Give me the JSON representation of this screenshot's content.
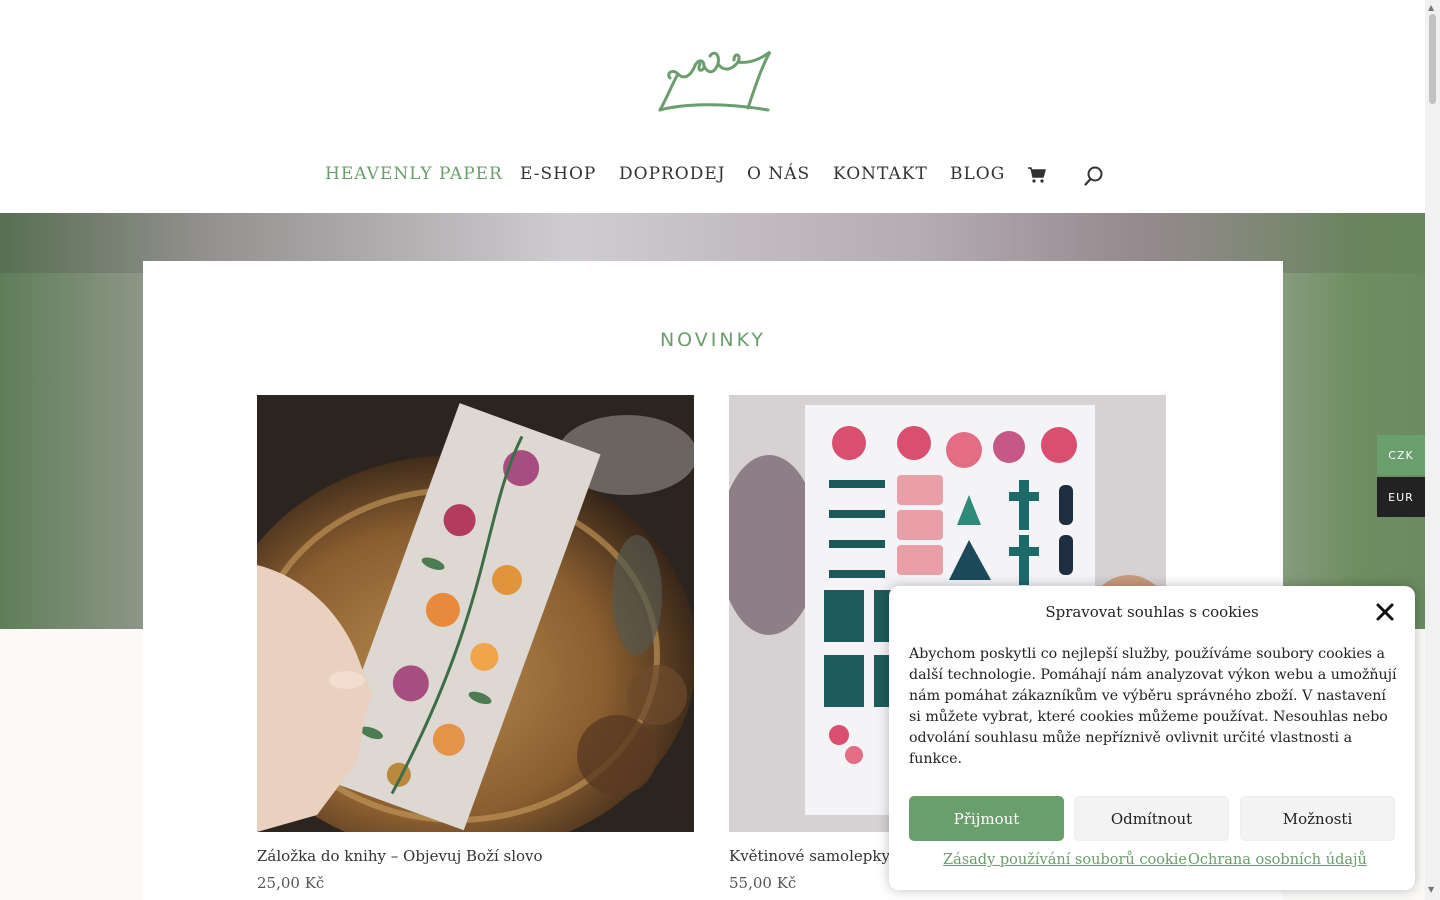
{
  "nav": {
    "items": [
      "HEAVENLY PAPER",
      "E-SHOP",
      "DOPRODEJ",
      "O NÁS",
      "KONTAKT",
      "BLOG"
    ]
  },
  "section": {
    "title": "NOVINKY"
  },
  "products": [
    {
      "name": "Záložka do knihy – Objevuj Boží slovo",
      "price": "25,00 Kč"
    },
    {
      "name": "Květinové samolepky c",
      "price": "55,00 Kč"
    }
  ],
  "currency": [
    "CZK",
    "EUR"
  ],
  "cookie": {
    "title": "Spravovat souhlas s cookies",
    "text": "Abychom poskytli co nejlepší služby, používáme soubory cookies a další technologie. Pomáhají nám analyzovat výkon webu a umožňují nám pomáhat zákazníkům ve výběru správného zboží. V nastavení si můžete vybrat, které cookies můžeme používat. Nesouhlas nebo odvolání souhlasu může nepříznivě ovlivnit určité vlastnosti a funkce.",
    "accept": "Přijmout",
    "deny": "Odmítnout",
    "options": "Možnosti",
    "link_policy": "Zásady používání souborů cookie",
    "link_privacy": "Ochrana osobních údajů"
  },
  "colors": {
    "accent": "#6a9e6c",
    "dark": "#222222"
  },
  "icons": [
    "crown-logo",
    "cart-icon",
    "search-icon",
    "close-icon"
  ]
}
